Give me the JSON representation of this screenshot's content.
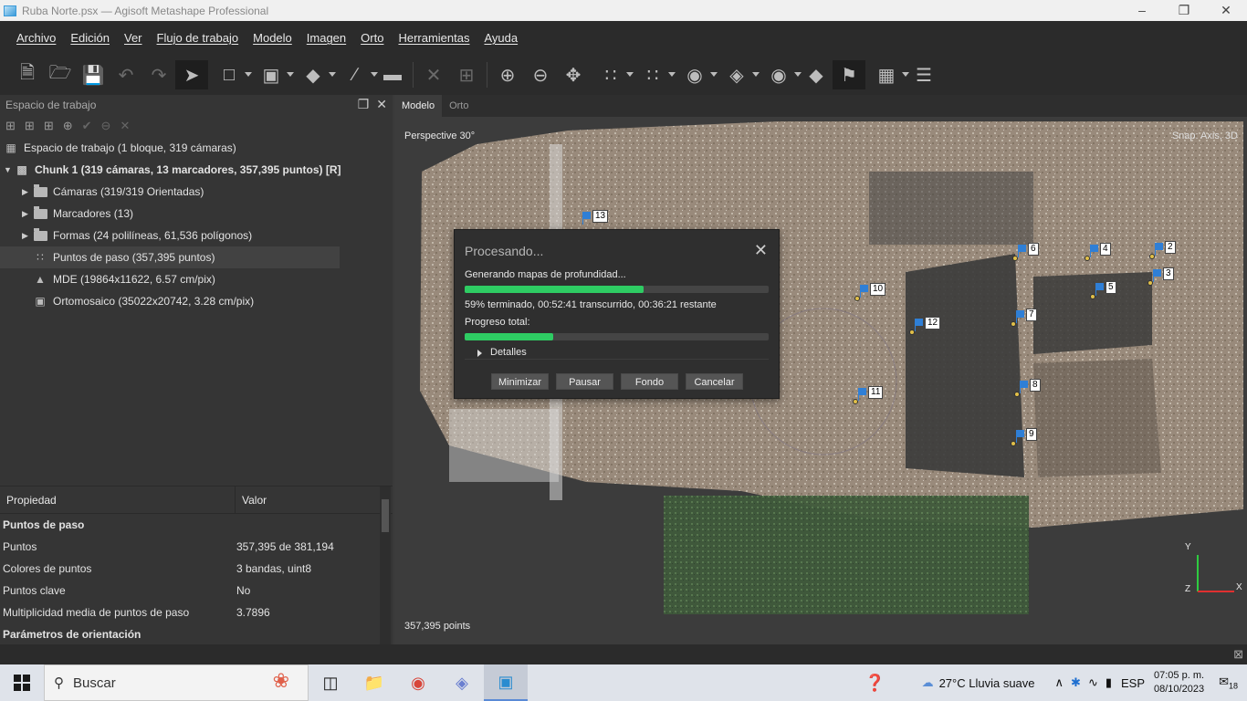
{
  "window": {
    "title": "Ruba Norte.psx — Agisoft Metashape Professional"
  },
  "menu": [
    "Archivo",
    "Edición",
    "Ver",
    "Flujo de trabajo",
    "Modelo",
    "Imagen",
    "Orto",
    "Herramientas",
    "Ayuda"
  ],
  "workspace": {
    "header": "Espacio de trabajo",
    "root": "Espacio de trabajo (1 bloque, 319 cámaras)",
    "chunk": "Chunk 1 (319 cámaras, 13 marcadores, 357,395 puntos) [R]",
    "items": [
      {
        "label": "Cámaras (319/319 Orientadas)",
        "icon": "folder-icon"
      },
      {
        "label": "Marcadores (13)",
        "icon": "folder-icon"
      },
      {
        "label": "Formas (24 polilíneas, 61,536 polígonos)",
        "icon": "folder-icon"
      },
      {
        "label": "Puntos de paso (357,395 puntos)",
        "icon": "tie-points-icon"
      },
      {
        "label": "MDE (19864x11622, 6.57 cm/pix)",
        "icon": "dem-icon"
      },
      {
        "label": "Ortomosaico (35022x20742, 3.28 cm/pix)",
        "icon": "orthomosaic-icon"
      }
    ]
  },
  "properties": {
    "col_property": "Propiedad",
    "col_value": "Valor",
    "rows": [
      {
        "key": "Puntos de paso",
        "value": "",
        "group": true
      },
      {
        "key": "Puntos",
        "value": "357,395 de 381,194"
      },
      {
        "key": "Colores de puntos",
        "value": "3 bandas, uint8"
      },
      {
        "key": "Puntos clave",
        "value": "No"
      },
      {
        "key": "Multiplicidad media de puntos de paso",
        "value": "3.7896"
      },
      {
        "key": "Parámetros de orientación",
        "value": "",
        "group": true
      }
    ]
  },
  "viewport": {
    "tabs": [
      "Modelo",
      "Orto"
    ],
    "perspective": "Perspective 30°",
    "snap": "Snap: Axis, 3D",
    "points": "357,395 points",
    "markers": [
      "13",
      "6",
      "4",
      "2",
      "3",
      "5",
      "10",
      "12",
      "7",
      "11",
      "8",
      "9"
    ],
    "axes": {
      "y": "Y",
      "x": "X",
      "z": "Z"
    }
  },
  "dialog": {
    "title": "Procesando...",
    "step": "Generando mapas de profundidad...",
    "step_progress": 0.59,
    "status": "59% terminado, 00:52:41 transcurrido, 00:36:21 restante",
    "total_label": "Progreso total:",
    "total_progress": 0.29,
    "details": "Detalles",
    "buttons": {
      "minimize": "Minimizar",
      "pause": "Pausar",
      "background": "Fondo",
      "cancel": "Cancelar"
    }
  },
  "taskbar": {
    "search_placeholder": "Buscar",
    "weather": "27°C  Lluvia suave",
    "lang": "ESP",
    "time": "07:05 p. m.",
    "date": "08/10/2023",
    "notifications": "18"
  }
}
